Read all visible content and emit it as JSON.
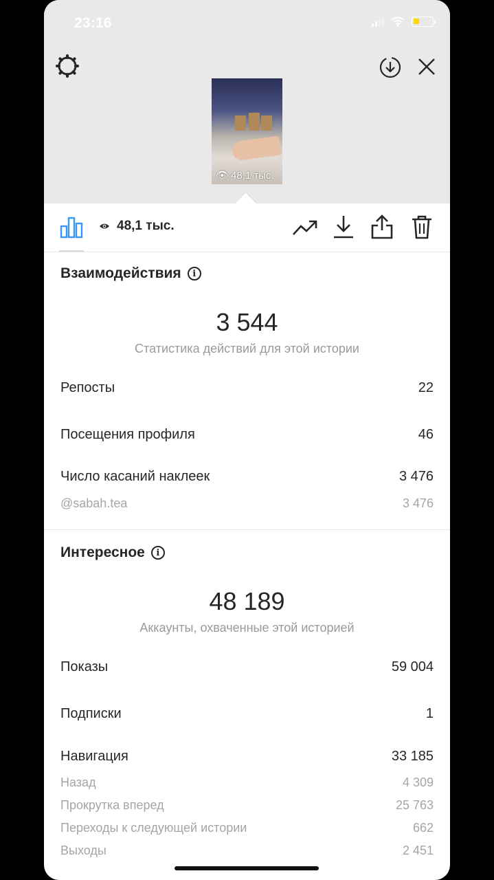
{
  "status_bar": {
    "time": "23:16"
  },
  "thumbnail": {
    "views": "48,1 тыс."
  },
  "toolbar": {
    "views": "48,1 тыс."
  },
  "interactions": {
    "title": "Взаимодействия",
    "total": "3 544",
    "caption": "Статистика действий для этой истории",
    "rows": [
      {
        "label": "Репосты",
        "value": "22"
      },
      {
        "label": "Посещения профиля",
        "value": "46"
      },
      {
        "label": "Число касаний наклеек",
        "value": "3 476"
      }
    ],
    "sub_rows": [
      {
        "label": "@sabah.tea",
        "value": "3 476"
      }
    ]
  },
  "discovery": {
    "title": "Интересное",
    "total": "48 189",
    "caption": "Аккаунты, охваченные этой историей",
    "rows": [
      {
        "label": "Показы",
        "value": "59 004"
      },
      {
        "label": "Подписки",
        "value": "1"
      },
      {
        "label": "Навигация",
        "value": "33 185"
      }
    ],
    "sub_rows": [
      {
        "label": "Назад",
        "value": "4 309"
      },
      {
        "label": "Прокрутка вперед",
        "value": "25 763"
      },
      {
        "label": "Переходы к следующей истории",
        "value": "662"
      },
      {
        "label": "Выходы",
        "value": "2 451"
      }
    ]
  },
  "icons": {
    "settings": "gear-icon",
    "download_circle": "download-circle-icon",
    "close": "close-icon",
    "insights": "bar-chart-icon",
    "eye": "eye-icon",
    "promote": "trending-up-icon",
    "save": "download-icon",
    "share": "share-icon",
    "delete": "trash-icon"
  },
  "colors": {
    "accent": "#3897f0",
    "battery": "#ffd60a"
  }
}
